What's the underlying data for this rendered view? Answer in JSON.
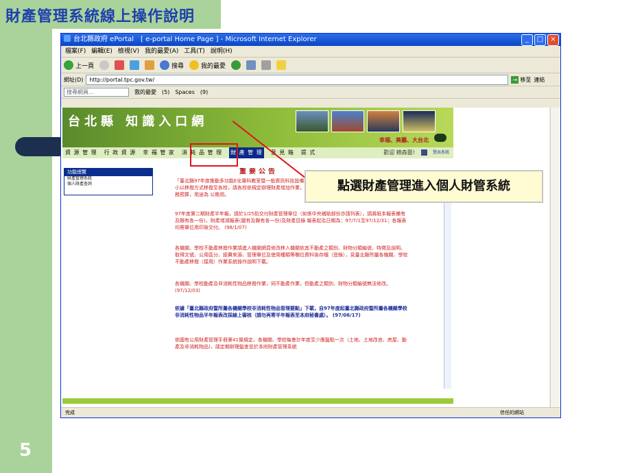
{
  "slide": {
    "title": "財產管理系統線上操作說明",
    "page_number": "5"
  },
  "browser": {
    "window_title": "台北縣政府 ePortal　[ e-portal Home Page ] - Microsoft Internet Explorer",
    "menu": [
      "檔案(F)",
      "編輯(E)",
      "檢視(V)",
      "我的最愛(A)",
      "工具(T)",
      "說明(H)"
    ],
    "toolbar": {
      "back": "上一頁",
      "search": "搜尋",
      "favorites": "我的最愛"
    },
    "address_label": "網址(D)",
    "address_url": "http://portal.tpc.gov.tw/",
    "go_label": "移至",
    "links_label": "連結",
    "search_placeholder": "搜尋網頁...",
    "searchbar_favorites": "我的最愛",
    "searchbar_count_5": "(5)",
    "searchbar_spaces": "Spaces",
    "searchbar_count_9": "(9)",
    "status_left": "完成",
    "status_right": "信任的網站"
  },
  "site": {
    "banner_title": "台北縣 知識入口網",
    "slogan": "幸福、美麗、大台北",
    "nav": [
      "資 源 管 理",
      "行 政 資 源",
      "幸 福 管 家",
      "消 耗 品 管 理",
      "財 產 管 理",
      "意 見 箱",
      "提 式"
    ],
    "greeting": "歡迎 賴森藝!",
    "logout": "登出系統",
    "side_title": "功能總覽",
    "side_items": [
      "財產管理系統",
      "個人財產查詢"
    ],
    "announce_title": "重要公告",
    "news": [
      {
        "text": "「臺北縣97年度推動多功能E化專科教室暨一般資訊科技設備採購案」業已完成統一建置基本資料，由鶯山國小以移撥方式移撥至各校，請各校依規定辦理財產增加作業，並一律使用新開發之財產系統，經費來源為1公務預算，用途為 公務用。",
        "color": "red"
      },
      {
        "text": "97年度第二期財產半年報，請於1/25前交付財產管理單位（如係中央補助部份亦請列表），請將紙本報表備有及縣有各一份)，財產增減報表(國有及縣有各一份)及財產目錄 報表起迄日期為：97/7/1至97/12/31；各報表均需單位用印後交付。 (98/1/07)",
        "color": "red"
      },
      {
        "text": "各機關、學校不動產移撥作業請進入機關網頁修改移入機關依其不動產之類別、財物分類編號、特徵及說明、取得文號、公用區分、經費來源、管理單位及使用種類等欄位資料後存檔（登錄），見臺北縣所屬各機關、學校不動產移撥（接用）作業系統操作說明下載。",
        "color": "red"
      },
      {
        "text": "各機關、學校動產及非消耗性物品移撥作業，同不動產作業，但動產之類別、財物分類編號無法修改。(97/12/03)",
        "color": "red"
      },
      {
        "text": "依據「臺北縣政府暨所屬各機關學校非消耗性物品管理要點」下載，自97年度起臺北縣政府暨所屬各機關學校非消耗性物品半年報表改採線上審核（請勿再寄半年報表至本府秘書處）。 (97/06/17)",
        "color": "blue"
      },
      {
        "text": "依國有公用財產管理手冊第41條規定，各機關、學校每會計年度至少應盤點一次（土地、土地改良、房屋、動產及非消耗物品)，請定期辦理盤查並於本府財產管理系統",
        "color": "red"
      }
    ]
  },
  "callout": "點選財產管理進入個人財管系統",
  "colors": {
    "slide_green": "#a9d39a",
    "title_blue": "#1f3fae",
    "highlight_red": "#e0141b",
    "callout_bg": "#fffbd2"
  }
}
